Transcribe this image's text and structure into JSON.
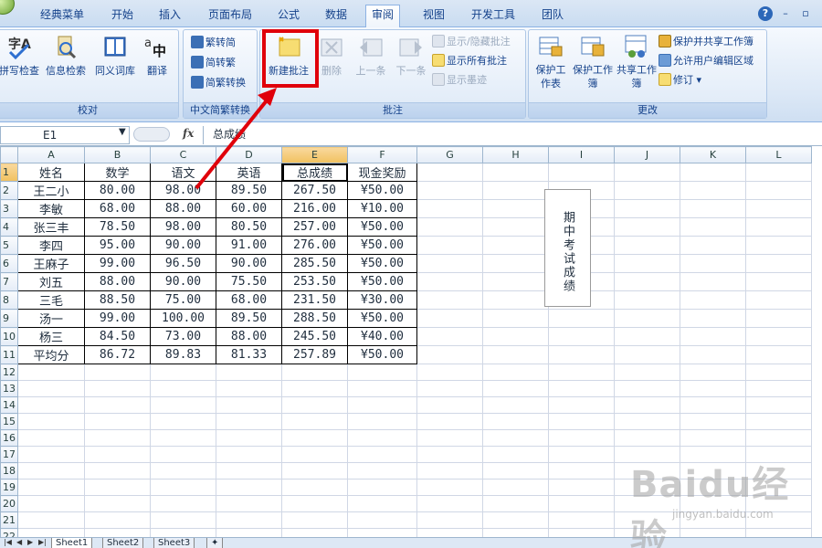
{
  "tabs": [
    "经典菜单",
    "开始",
    "插入",
    "页面布局",
    "公式",
    "数据",
    "审阅",
    "视图",
    "开发工具",
    "团队"
  ],
  "active_tab": "审阅",
  "ribbon": {
    "proofing": {
      "label": "校对",
      "buttons": [
        "拼写检查",
        "信息检索",
        "同义词库",
        "翻译"
      ]
    },
    "chinese": {
      "label": "中文简繁转换",
      "buttons": [
        "繁转简",
        "简转繁",
        "简繁转换"
      ]
    },
    "comments": {
      "label": "批注",
      "new": "新建批注",
      "delete": "删除",
      "prev": "上一条",
      "next": "下一条",
      "show_hide": "显示/隐藏批注",
      "show_all": "显示所有批注",
      "show_ink": "显示墨迹"
    },
    "changes": {
      "label": "更改",
      "protect_sheet": "保护工作表",
      "protect_workbook": "保护工作簿",
      "share_workbook": "共享工作簿",
      "protect_share": "保护并共享工作簿",
      "allow_edit": "允许用户编辑区域",
      "track": "修订"
    }
  },
  "formula_bar": {
    "name_box": "E1",
    "fx": "fx",
    "content": "总成绩"
  },
  "columns": [
    "A",
    "B",
    "C",
    "D",
    "E",
    "F",
    "G",
    "H",
    "I",
    "J",
    "K",
    "L"
  ],
  "rows": [
    "1",
    "2",
    "3",
    "4",
    "5",
    "6",
    "7",
    "8",
    "9",
    "10",
    "11",
    "12",
    "13",
    "14",
    "15",
    "16",
    "17",
    "18",
    "19",
    "20",
    "21",
    "22",
    "23"
  ],
  "table": {
    "headers": [
      "姓名",
      "数学",
      "语文",
      "英语",
      "总成绩",
      "现金奖励"
    ],
    "data": [
      [
        "王二小",
        "80.00",
        "98.00",
        "89.50",
        "267.50",
        "¥50.00"
      ],
      [
        "李敏",
        "68.00",
        "88.00",
        "60.00",
        "216.00",
        "¥10.00"
      ],
      [
        "张三丰",
        "78.50",
        "98.00",
        "80.50",
        "257.00",
        "¥50.00"
      ],
      [
        "李四",
        "95.00",
        "90.00",
        "91.00",
        "276.00",
        "¥50.00"
      ],
      [
        "王麻子",
        "99.00",
        "96.50",
        "90.00",
        "285.50",
        "¥50.00"
      ],
      [
        "刘五",
        "88.00",
        "90.00",
        "75.50",
        "253.50",
        "¥50.00"
      ],
      [
        "三毛",
        "88.50",
        "75.00",
        "68.00",
        "231.50",
        "¥30.00"
      ],
      [
        "汤一",
        "99.00",
        "100.00",
        "89.50",
        "288.50",
        "¥50.00"
      ],
      [
        "杨三",
        "84.50",
        "73.00",
        "88.00",
        "245.50",
        "¥40.00"
      ],
      [
        "平均分",
        "86.72",
        "89.83",
        "81.33",
        "257.89",
        "¥50.00"
      ]
    ]
  },
  "comment_box_text": "期中考试成绩",
  "sheet_tabs": [
    "Sheet1",
    "Sheet2",
    "Sheet3"
  ],
  "watermark": {
    "main": "Baidu经验",
    "sub": "jingyan.baidu.com"
  },
  "colors": {
    "highlight": "#e0000a",
    "arrow": "#e0000a"
  }
}
